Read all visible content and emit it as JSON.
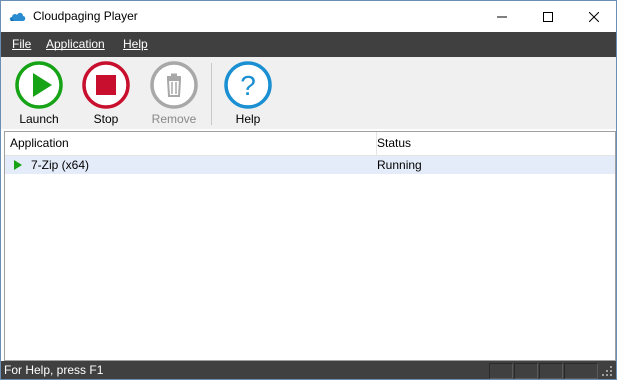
{
  "window": {
    "title": "Cloudpaging Player",
    "icon": "cloud-icon",
    "controls": {
      "minimize": "minimize-icon",
      "maximize": "maximize-icon",
      "close": "close-icon"
    }
  },
  "menu": {
    "items": [
      {
        "label": "File",
        "accesskey": "F"
      },
      {
        "label": "Application",
        "accesskey": "A"
      },
      {
        "label": "Help",
        "accesskey": "H"
      }
    ]
  },
  "toolbar": {
    "buttons": [
      {
        "label": "Launch",
        "icon": "play-icon",
        "enabled": true
      },
      {
        "label": "Stop",
        "icon": "stop-icon",
        "enabled": true
      },
      {
        "label": "Remove",
        "icon": "trash-icon",
        "enabled": false
      },
      {
        "label": "Help",
        "icon": "question-icon",
        "enabled": true
      }
    ]
  },
  "list": {
    "columns": [
      "Application",
      "Status"
    ],
    "rows": [
      {
        "name": "7-Zip (x64)",
        "status": "Running",
        "icon": "running-play-icon"
      }
    ]
  },
  "statusbar": {
    "text": "For Help, press F1"
  },
  "colors": {
    "menubar": "#404040",
    "launch": "#16a316",
    "stop": "#c8102e",
    "remove": "#a8a8a8",
    "help": "#1a8fd1",
    "selected_row": "#e5ecf9"
  }
}
